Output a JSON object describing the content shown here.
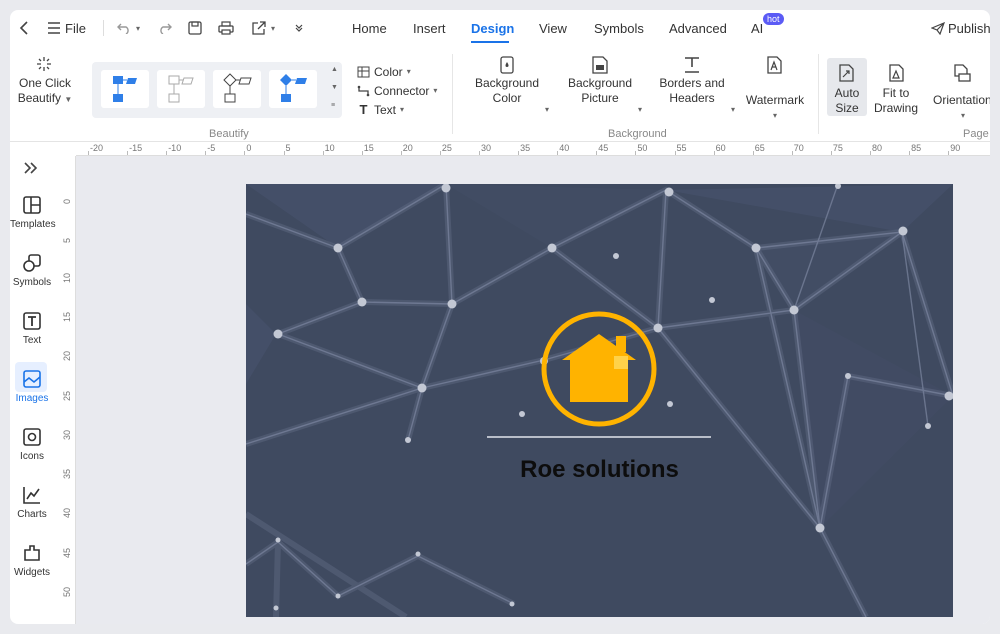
{
  "toolbar": {
    "file_label": "File",
    "publish_label": "Publish"
  },
  "menu": {
    "tabs": [
      "Home",
      "Insert",
      "Design",
      "View",
      "Symbols",
      "Advanced",
      "AI"
    ],
    "active": "Design",
    "ai_badge": "hot"
  },
  "ribbon": {
    "one_click_line1": "One Click",
    "one_click_line2": "Beautify",
    "color_label": "Color",
    "connector_label": "Connector",
    "text_label": "Text",
    "beautify_group": "Beautify",
    "bg_color_line1": "Background",
    "bg_color_line2": "Color",
    "bg_picture_line1": "Background",
    "bg_picture_line2": "Picture",
    "borders_line1": "Borders and",
    "borders_line2": "Headers",
    "watermark_label": "Watermark",
    "background_group": "Background",
    "autosize_line1": "Auto",
    "autosize_line2": "Size",
    "fit_line1": "Fit to",
    "fit_line2": "Drawing",
    "orientation_label": "Orientation",
    "page_group": "Page"
  },
  "sidebar": {
    "items": [
      "Templates",
      "Symbols",
      "Text",
      "Images",
      "Icons",
      "Charts",
      "Widgets"
    ],
    "active": "Images"
  },
  "ruler": {
    "top": [
      "-20",
      "-15",
      "-10",
      "-5",
      "0",
      "5",
      "10",
      "15",
      "20",
      "25",
      "30",
      "35",
      "40",
      "45",
      "50",
      "55",
      "60",
      "65",
      "70",
      "75",
      "80",
      "85",
      "90"
    ],
    "left": [
      "0",
      "5",
      "10",
      "15",
      "20",
      "25",
      "30",
      "35",
      "40",
      "45",
      "50",
      "5"
    ]
  },
  "document": {
    "title": "Roe solutions"
  },
  "colors": {
    "accent": "#1a73e8",
    "page_background": "#3f4a60",
    "logo": "#ffb300"
  }
}
